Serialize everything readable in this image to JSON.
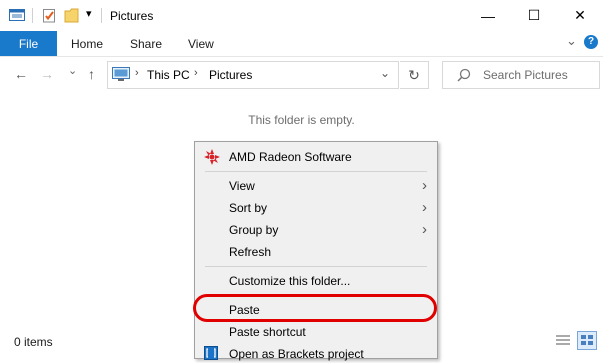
{
  "window": {
    "title": "Pictures",
    "minimize_glyph": "—",
    "maximize_glyph": "☐",
    "close_glyph": "✕"
  },
  "ribbon": {
    "tabs": [
      "File",
      "Home",
      "Share",
      "View"
    ],
    "expand_glyph": "⌄",
    "help_glyph": "?"
  },
  "nav": {
    "back_glyph": "←",
    "forward_glyph": "→",
    "recent_glyph": "⌄",
    "up_glyph": "↑"
  },
  "address": {
    "crumbs": [
      "This PC",
      "Pictures"
    ],
    "separator": "›",
    "refresh_glyph": "↻"
  },
  "search": {
    "placeholder": "Search Pictures"
  },
  "content": {
    "empty_message": "This folder is empty."
  },
  "status": {
    "item_count": "0 items"
  },
  "context_menu": {
    "top_item": "AMD Radeon Software",
    "items": [
      {
        "label": "View",
        "submenu": "›"
      },
      {
        "label": "Sort by",
        "submenu": "›"
      },
      {
        "label": "Group by",
        "submenu": "›"
      },
      {
        "label": "Refresh"
      },
      {
        "label": "Customize this folder..."
      },
      {
        "label": "Paste"
      },
      {
        "label": "Paste shortcut"
      },
      {
        "label": "Open as Brackets project"
      }
    ]
  },
  "colors": {
    "file_tab": "#1979ca",
    "highlight": "#e10000",
    "amd_red": "#d8232a"
  }
}
